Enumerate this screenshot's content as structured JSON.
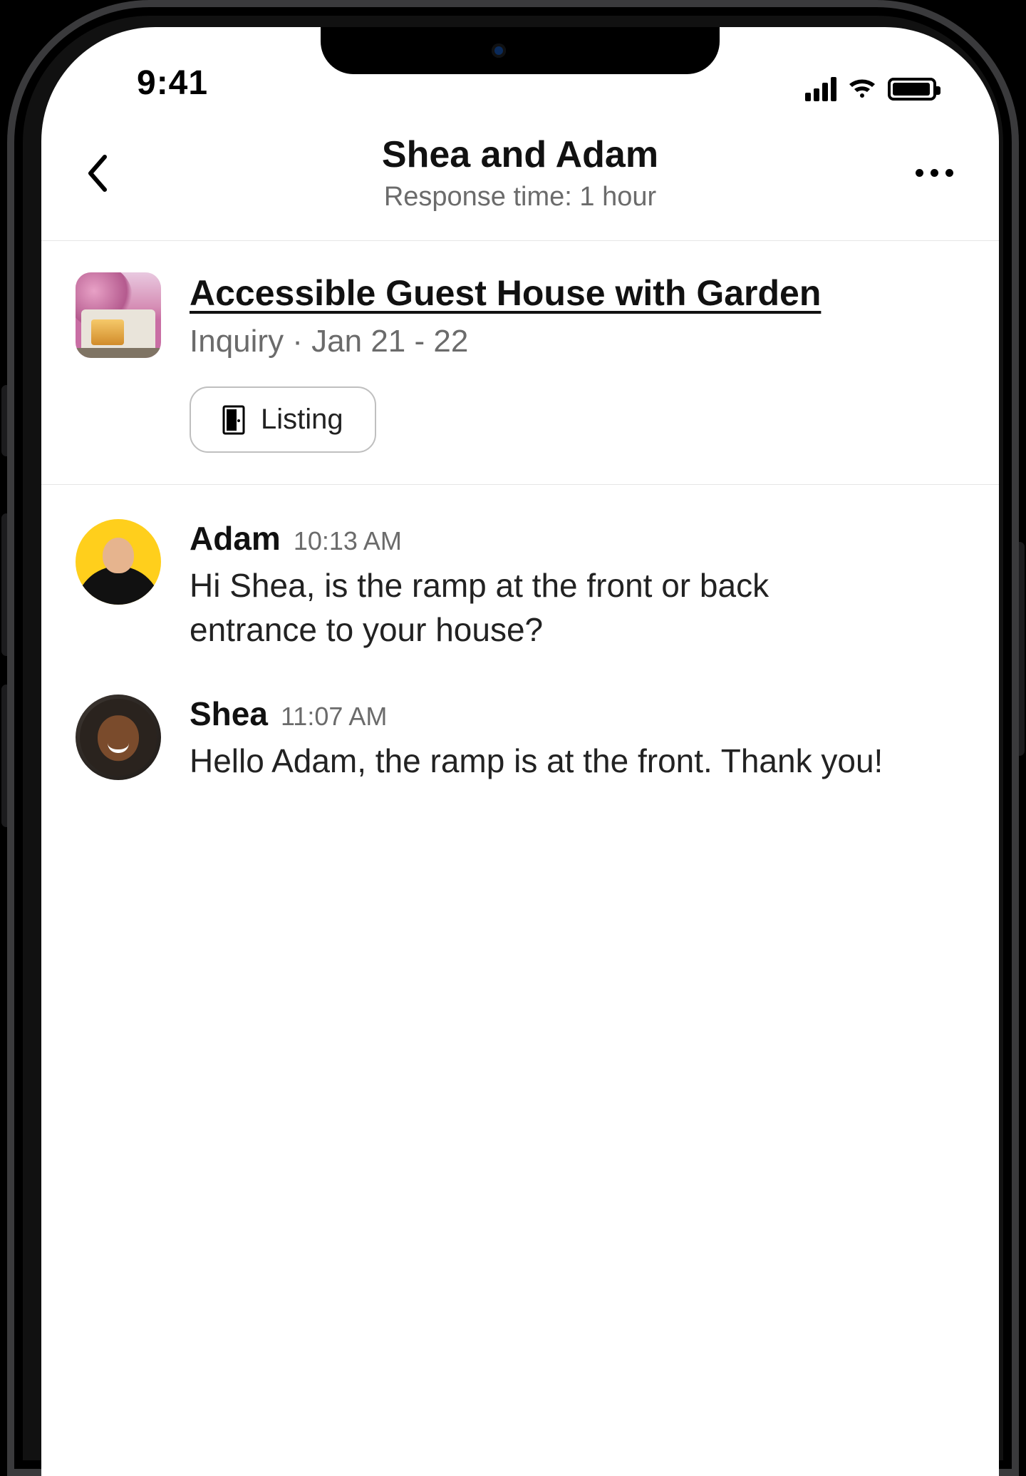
{
  "statusbar": {
    "time": "9:41"
  },
  "header": {
    "title": "Shea and Adam",
    "subtitle": "Response time: 1 hour"
  },
  "listing": {
    "title": "Accessible Guest House with Garden",
    "meta": "Inquiry · Jan 21 - 22",
    "chip_label": "Listing"
  },
  "messages": [
    {
      "name": "Adam",
      "time": "10:13 AM",
      "body": "Hi Shea, is the ramp at the front or back entrance to your house?",
      "avatar": "adam"
    },
    {
      "name": "Shea",
      "time": "11:07 AM",
      "body": "Hello Adam, the ramp is at the front. Thank you!",
      "avatar": "shea"
    }
  ]
}
